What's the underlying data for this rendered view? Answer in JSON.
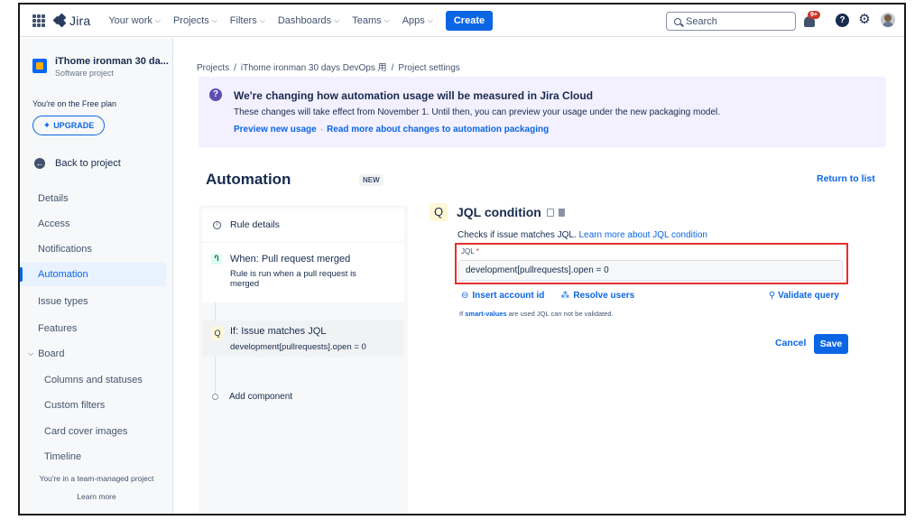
{
  "topnav": {
    "logo_text": "Jira",
    "items": [
      {
        "label": "Your work"
      },
      {
        "label": "Projects"
      },
      {
        "label": "Filters"
      },
      {
        "label": "Dashboards"
      },
      {
        "label": "Teams"
      },
      {
        "label": "Apps"
      }
    ],
    "create_label": "Create",
    "search_placeholder": "Search",
    "notification_badge": "9+",
    "help_glyph": "?"
  },
  "sidebar": {
    "project_name": "iThome ironman 30 da...",
    "project_type": "Software project",
    "plan_text": "You're on the Free plan",
    "upgrade_label": "UPGRADE",
    "back_label": "Back to project",
    "items": [
      {
        "label": "Details"
      },
      {
        "label": "Access"
      },
      {
        "label": "Notifications"
      },
      {
        "label": "Automation"
      },
      {
        "label": "Issue types"
      },
      {
        "label": "Features"
      },
      {
        "label": "Board"
      },
      {
        "label": "Columns and statuses"
      },
      {
        "label": "Custom filters"
      },
      {
        "label": "Card cover images"
      },
      {
        "label": "Timeline"
      }
    ],
    "team_note": "You're in a team-managed project",
    "learn_more": "Learn more"
  },
  "breadcrumb": {
    "parts": [
      "Projects",
      "iThome ironman 30 days DevOps 用",
      "Project settings"
    ],
    "separator": "/"
  },
  "banner": {
    "title": "We're changing how automation usage will be measured in Jira Cloud",
    "body": "These changes will take effect from November 1. Until then, you can preview your usage under the new packaging model.",
    "link1": "Preview new usage",
    "link_sep": "·",
    "link2": "Read more about changes to automation packaging"
  },
  "automation": {
    "title": "Automation",
    "new_badge": "NEW",
    "return_link": "Return to list"
  },
  "rule": {
    "details_label": "Rule details",
    "trigger_icon": "Ⴄ",
    "trigger_title": "When: Pull request merged",
    "trigger_desc": "Rule is run when a pull request is merged",
    "condition_icon": "Q",
    "condition_title": "If: Issue matches JQL",
    "condition_desc": "development[pullrequests].open = 0",
    "add_component": "Add component"
  },
  "jql_condition": {
    "icon_glyph": "Q",
    "title": "JQL condition",
    "checks_text": "Checks if issue matches JQL.",
    "checks_link": "Learn more about JQL condition",
    "field_label": "JQL",
    "required_mark": "*",
    "field_value": "development[pullrequests].open = 0",
    "insert_account": "Insert account id",
    "resolve_users": "Resolve users",
    "validate_query": "Validate query",
    "smart_values_bold": "smart-values",
    "smart_prefix": "If",
    "smart_suffix": "are used JQL can not be validated.",
    "cancel_label": "Cancel",
    "save_label": "Save",
    "highlight_color": "#e5302e"
  }
}
